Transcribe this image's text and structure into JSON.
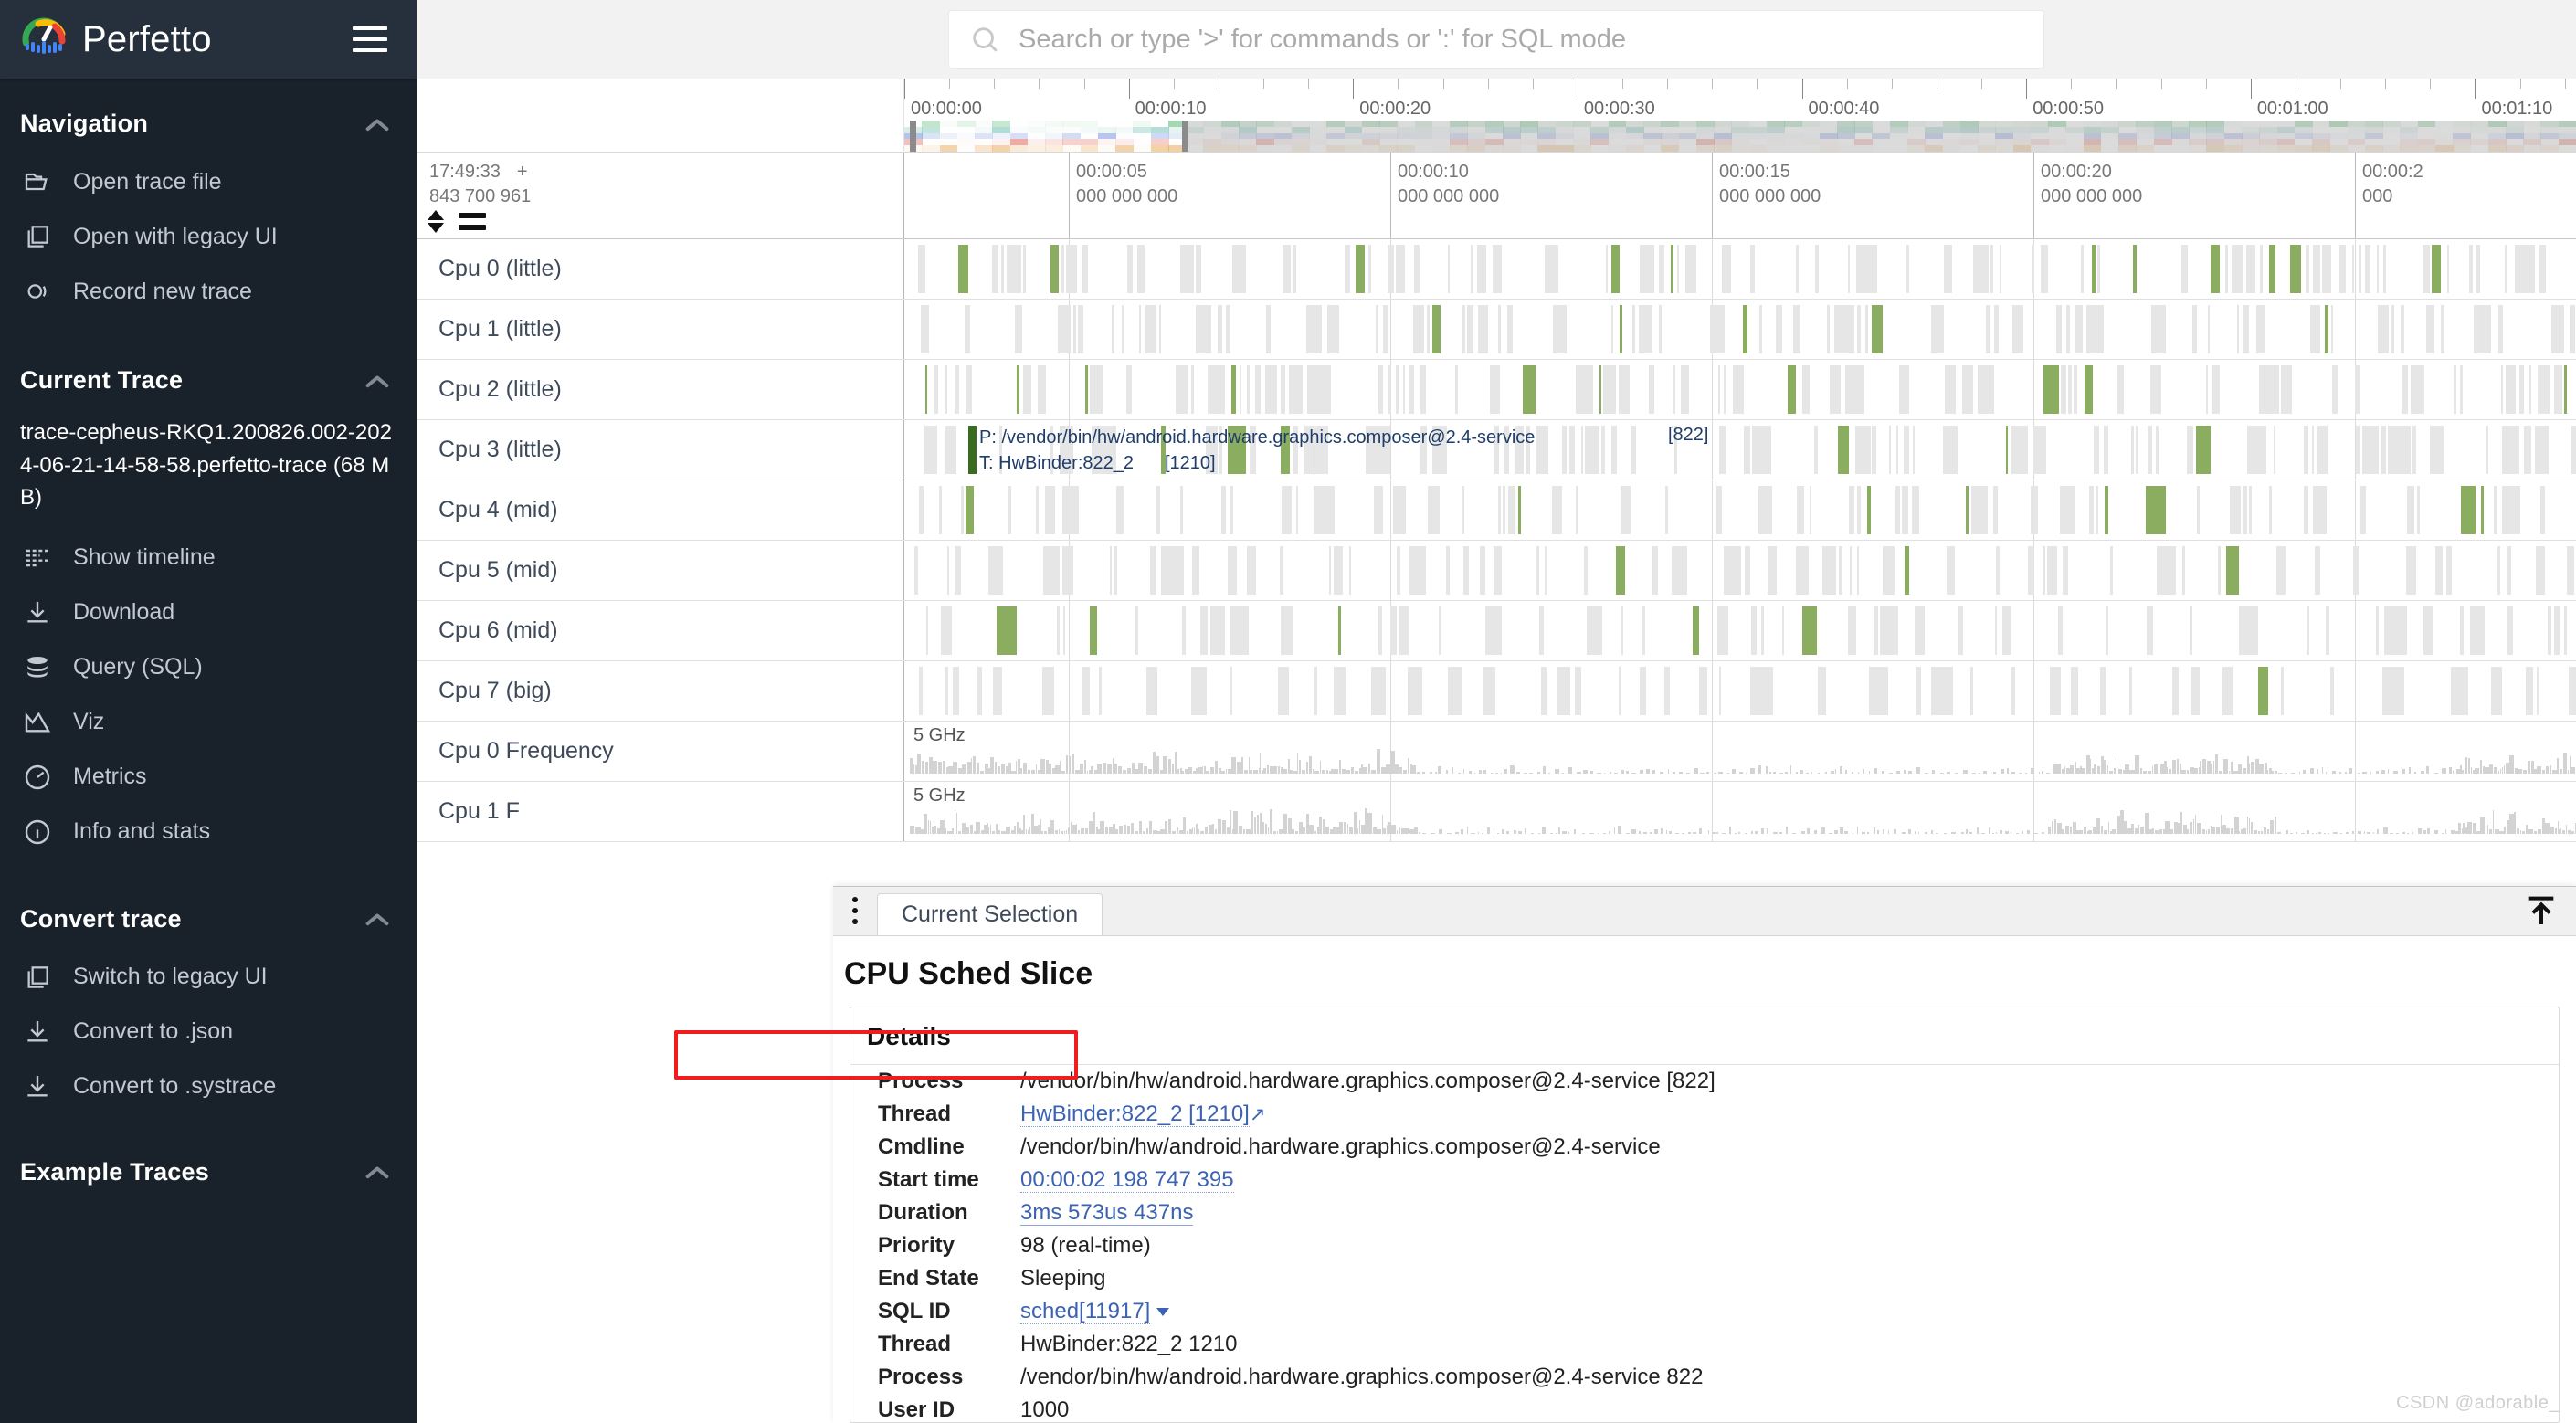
{
  "app": {
    "brand": "Perfetto",
    "menu_icon": "hamburger-icon"
  },
  "search": {
    "placeholder": "Search or type '>' for commands or ':' for SQL mode",
    "value": "",
    "icon": "search-icon"
  },
  "sidebar": {
    "sections": [
      {
        "title": "Navigation",
        "items": [
          {
            "label": "Open trace file",
            "icon": "folder-open-icon"
          },
          {
            "label": "Open with legacy UI",
            "icon": "copy-icon"
          },
          {
            "label": "Record new trace",
            "icon": "record-icon"
          }
        ]
      },
      {
        "title": "Current Trace",
        "trace_name": "trace-cepheus-RKQ1.200826.002-2024-06-21-14-58-58.perfetto-trace (68 MB)",
        "items": [
          {
            "label": "Show timeline",
            "icon": "timeline-icon"
          },
          {
            "label": "Download",
            "icon": "download-icon"
          },
          {
            "label": "Query (SQL)",
            "icon": "database-icon"
          },
          {
            "label": "Viz",
            "icon": "chart-icon"
          },
          {
            "label": "Metrics",
            "icon": "gauge-icon"
          },
          {
            "label": "Info and stats",
            "icon": "info-icon"
          }
        ]
      },
      {
        "title": "Convert trace",
        "items": [
          {
            "label": "Switch to legacy UI",
            "icon": "copy-icon"
          },
          {
            "label": "Convert to .json",
            "icon": "download-icon"
          },
          {
            "label": "Convert to .systrace",
            "icon": "download-icon"
          }
        ]
      },
      {
        "title": "Example Traces",
        "items": []
      }
    ]
  },
  "overview": {
    "ruler_labels": [
      "00:00:00",
      "00:00:10",
      "00:00:20",
      "00:00:30",
      "00:00:40",
      "00:00:50",
      "00:01:00",
      "00:01:10"
    ],
    "selection_start_pct": 0.5,
    "selection_end_pct": 16.8
  },
  "time_header": {
    "absolute_time": "17:49:33",
    "absolute_plus": "+",
    "absolute_nanos": "843 700 961",
    "stamps": [
      {
        "time": "00:00:05",
        "nanos": "000 000 000"
      },
      {
        "time": "00:00:10",
        "nanos": "000 000 000"
      },
      {
        "time": "00:00:15",
        "nanos": "000 000 000"
      },
      {
        "time": "00:00:20",
        "nanos": "000 000 000"
      },
      {
        "time": "00:00:2",
        "nanos": "000 "
      }
    ]
  },
  "tracks": [
    {
      "label": "Cpu 0 (little)",
      "kind": "sched"
    },
    {
      "label": "Cpu 1 (little)",
      "kind": "sched"
    },
    {
      "label": "Cpu 2 (little)",
      "kind": "sched"
    },
    {
      "label": "Cpu 3 (little)",
      "kind": "sched"
    },
    {
      "label": "Cpu 4 (mid)",
      "kind": "sched"
    },
    {
      "label": "Cpu 5 (mid)",
      "kind": "sched"
    },
    {
      "label": "Cpu 6 (mid)",
      "kind": "sched"
    },
    {
      "label": "Cpu 7 (big)",
      "kind": "sched"
    },
    {
      "label": "Cpu 0 Frequency",
      "kind": "freq",
      "scale": "5 GHz"
    },
    {
      "label": "Cpu 1 F",
      "kind": "freq",
      "scale": "5 GHz"
    }
  ],
  "selected_slice_label": {
    "process_line": "P: /vendor/bin/hw/android.hardware.graphics.composer@2.4-service",
    "thread_line": "T: HwBinder:822_2",
    "thread_tid": "[1210]",
    "process_pid": "[822]"
  },
  "bottom_panel": {
    "tab": "Current Selection",
    "title": "CPU Sched Slice",
    "details_header": "Details",
    "collapse_icon": "collapse-up-icon",
    "overflow_icon": "more-vertical-icon",
    "rows": [
      {
        "key": "Process",
        "value": "/vendor/bin/hw/android.hardware.graphics.composer@2.4-service [822]",
        "link": false
      },
      {
        "key": "Thread",
        "value": "HwBinder:822_2 [1210]",
        "link": true,
        "external": true
      },
      {
        "key": "Cmdline",
        "value": "/vendor/bin/hw/android.hardware.graphics.composer@2.4-service",
        "link": false
      },
      {
        "key": "Start time",
        "value": "00:00:02 198 747 395",
        "link": true
      },
      {
        "key": "Duration",
        "value": "3ms 573us 437ns",
        "link": true,
        "highlighted": true
      },
      {
        "key": "Priority",
        "value": "98 (real-time)",
        "link": false
      },
      {
        "key": "End State",
        "value": "Sleeping",
        "link": false
      },
      {
        "key": "SQL ID",
        "value": "sched[11917]",
        "link": true,
        "dropdown": true
      },
      {
        "key": "Thread",
        "value": "HwBinder:822_2 1210",
        "link": false
      },
      {
        "key": "Process",
        "value": "/vendor/bin/hw/android.hardware.graphics.composer@2.4-service 822",
        "link": false
      },
      {
        "key": "User ID",
        "value": "1000",
        "link": false
      }
    ]
  },
  "watermark": "CSDN @adorable_",
  "colors": {
    "sidebar_bg": "#19212b",
    "sidebar_header_bg": "#262f3c",
    "link": "#3b62b3",
    "highlight": "#ef1d1d",
    "track_label": "#3e4a5a",
    "sched_green": "#8aad5f"
  }
}
